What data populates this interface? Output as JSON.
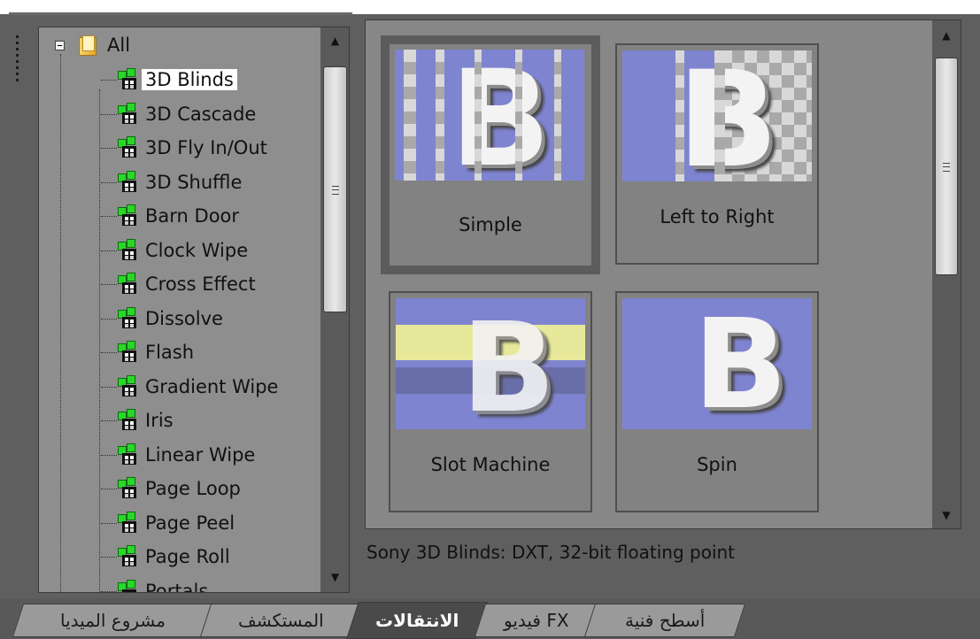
{
  "tree": {
    "root_label": "All",
    "items": [
      {
        "label": "3D Blinds"
      },
      {
        "label": "3D Cascade"
      },
      {
        "label": "3D Fly In/Out"
      },
      {
        "label": "3D Shuffle"
      },
      {
        "label": "Barn Door"
      },
      {
        "label": "Clock Wipe"
      },
      {
        "label": "Cross Effect"
      },
      {
        "label": "Dissolve"
      },
      {
        "label": "Flash"
      },
      {
        "label": "Gradient Wipe"
      },
      {
        "label": "Iris"
      },
      {
        "label": "Linear Wipe"
      },
      {
        "label": "Page Loop"
      },
      {
        "label": "Page Peel"
      },
      {
        "label": "Page Roll"
      },
      {
        "label": "Portals"
      }
    ],
    "selected": "3D Blinds"
  },
  "presets": [
    {
      "label": "Simple",
      "thumb_letter": "B"
    },
    {
      "label": "Left to Right",
      "thumb_letter": "B"
    },
    {
      "label": "Slot Machine",
      "thumb_letter": "B"
    },
    {
      "label": "Spin",
      "thumb_letter": "B"
    }
  ],
  "description": "Sony 3D Blinds: DXT, 32-bit floating point",
  "tabs": [
    {
      "label": "مشروع الميديا",
      "active": false
    },
    {
      "label": "المستكشف",
      "active": false
    },
    {
      "label": "الانتقالات",
      "active": true
    },
    {
      "label": "فيديو FX",
      "active": false
    },
    {
      "label": "أسطح فنية",
      "active": false
    }
  ],
  "icons": {
    "expander": "collapse-minus-icon",
    "folder": "folder-icon",
    "transition": "transition-icon",
    "scroll_up": "scroll-up-arrow-icon",
    "scroll_down": "scroll-down-arrow-icon"
  },
  "colors": {
    "panel_bg": "#878787",
    "thumbnail_bg": "#7f84d0",
    "active_tab": "#4a4a4a"
  }
}
